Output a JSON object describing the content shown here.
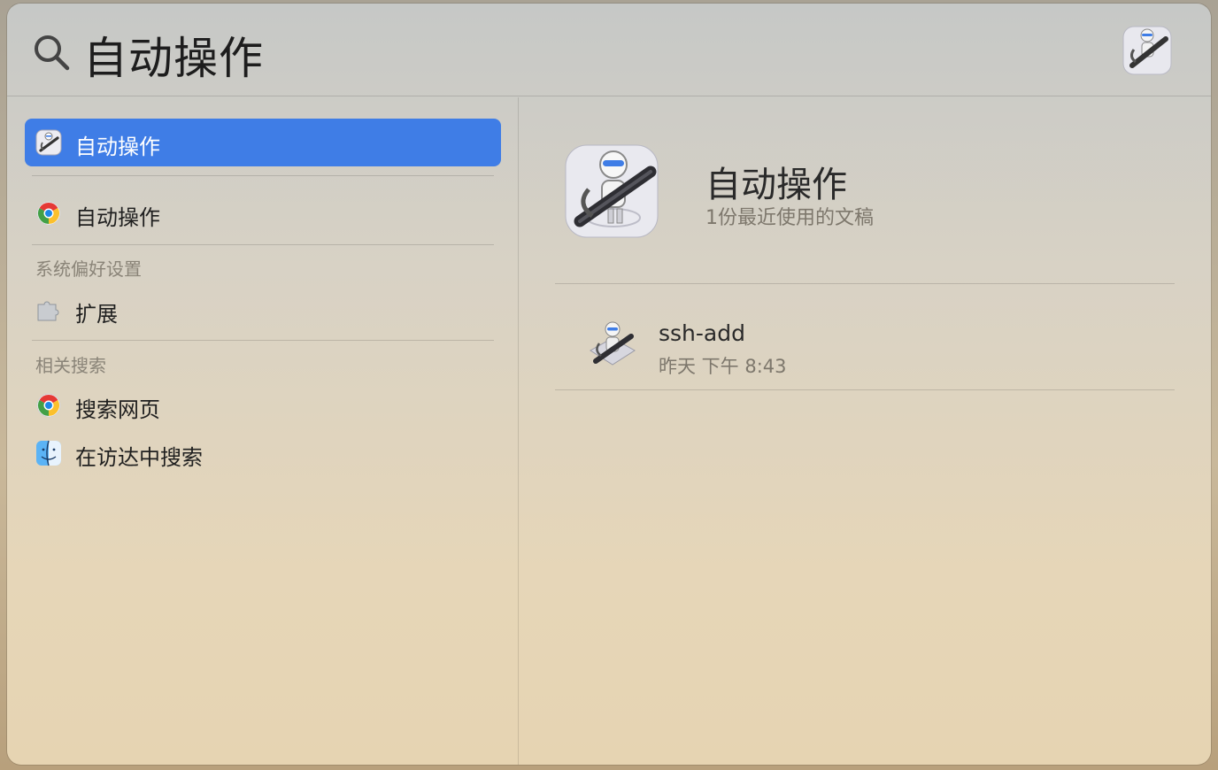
{
  "search": {
    "query": "自动操作"
  },
  "results": {
    "top_hit": {
      "label": "自动操作",
      "icon": "automator-icon"
    },
    "web": {
      "label": "自动操作",
      "icon": "chrome-icon"
    },
    "system_prefs": {
      "heading": "系统偏好设置",
      "items": [
        {
          "label": "扩展",
          "icon": "extensions-puzzle-icon"
        }
      ]
    },
    "related": {
      "heading": "相关搜索",
      "items": [
        {
          "label": "搜索网页",
          "icon": "chrome-icon"
        },
        {
          "label": "在访达中搜索",
          "icon": "finder-icon"
        }
      ]
    }
  },
  "preview": {
    "title": "自动操作",
    "subtitle": "1份最近使用的文稿",
    "documents": [
      {
        "name": "ssh-add",
        "time": "昨天 下午 8:43"
      }
    ]
  },
  "colors": {
    "selection": "#3f7de6"
  }
}
